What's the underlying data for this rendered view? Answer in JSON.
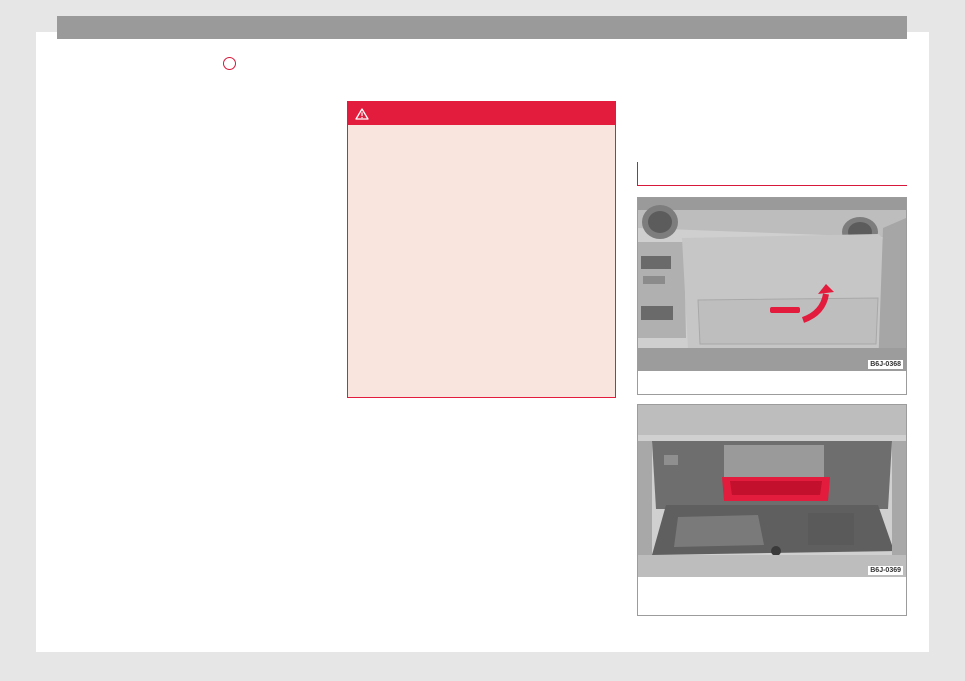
{
  "figures": [
    {
      "code": "B6J-0368",
      "caption": ""
    },
    {
      "code": "B6J-0369",
      "caption": ""
    }
  ],
  "icons": [
    "warning-triangle-icon"
  ],
  "colors": {
    "accent": "#e31b3d",
    "warning_background": "#fae4de",
    "header_bar": "#9a9a9a"
  }
}
